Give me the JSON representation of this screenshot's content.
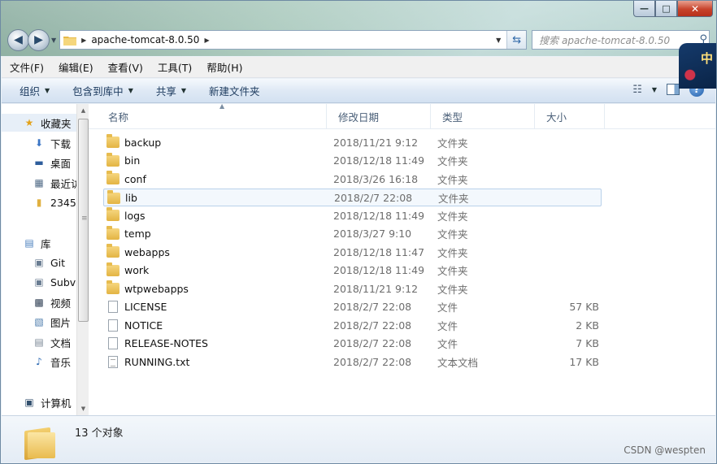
{
  "window": {
    "caption_buttons": {
      "minimize": "—",
      "maximize": "□",
      "close": "✕"
    }
  },
  "address_bar": {
    "path_segment": "apache-tomcat-8.0.50",
    "search_placeholder": "搜索 apache-tomcat-8.0.50"
  },
  "ime_badge": "中",
  "menu": [
    "文件(F)",
    "编辑(E)",
    "查看(V)",
    "工具(T)",
    "帮助(H)"
  ],
  "commands": {
    "organize": "组织",
    "include_in_library": "包含到库中",
    "share": "共享",
    "new_folder": "新建文件夹"
  },
  "nav_pane": {
    "favorites": "收藏夹",
    "fav_items": [
      "下载",
      "桌面",
      "最近访",
      "2345"
    ],
    "libraries": "库",
    "lib_items": [
      "Git",
      "Subv",
      "视频",
      "图片",
      "文档",
      "音乐"
    ],
    "computer": "计算机"
  },
  "columns": {
    "name": "名称",
    "date": "修改日期",
    "type": "类型",
    "size": "大小"
  },
  "files": [
    {
      "name": "backup",
      "date": "2018/11/21 9:12",
      "type": "文件夹",
      "size": "",
      "kind": "folder"
    },
    {
      "name": "bin",
      "date": "2018/12/18 11:49",
      "type": "文件夹",
      "size": "",
      "kind": "folder"
    },
    {
      "name": "conf",
      "date": "2018/3/26 16:18",
      "type": "文件夹",
      "size": "",
      "kind": "folder"
    },
    {
      "name": "lib",
      "date": "2018/2/7 22:08",
      "type": "文件夹",
      "size": "",
      "kind": "folder"
    },
    {
      "name": "logs",
      "date": "2018/12/18 11:49",
      "type": "文件夹",
      "size": "",
      "kind": "folder"
    },
    {
      "name": "temp",
      "date": "2018/3/27 9:10",
      "type": "文件夹",
      "size": "",
      "kind": "folder"
    },
    {
      "name": "webapps",
      "date": "2018/12/18 11:47",
      "type": "文件夹",
      "size": "",
      "kind": "folder"
    },
    {
      "name": "work",
      "date": "2018/12/18 11:49",
      "type": "文件夹",
      "size": "",
      "kind": "folder"
    },
    {
      "name": "wtpwebapps",
      "date": "2018/11/21 9:12",
      "type": "文件夹",
      "size": "",
      "kind": "folder"
    },
    {
      "name": "LICENSE",
      "date": "2018/2/7 22:08",
      "type": "文件",
      "size": "57 KB",
      "kind": "file"
    },
    {
      "name": "NOTICE",
      "date": "2018/2/7 22:08",
      "type": "文件",
      "size": "2 KB",
      "kind": "file"
    },
    {
      "name": "RELEASE-NOTES",
      "date": "2018/2/7 22:08",
      "type": "文件",
      "size": "7 KB",
      "kind": "file"
    },
    {
      "name": "RUNNING.txt",
      "date": "2018/2/7 22:08",
      "type": "文本文档",
      "size": "17 KB",
      "kind": "txt"
    }
  ],
  "selected_index": 3,
  "details": {
    "count": "13 个对象"
  },
  "watermark": "CSDN @wespten"
}
